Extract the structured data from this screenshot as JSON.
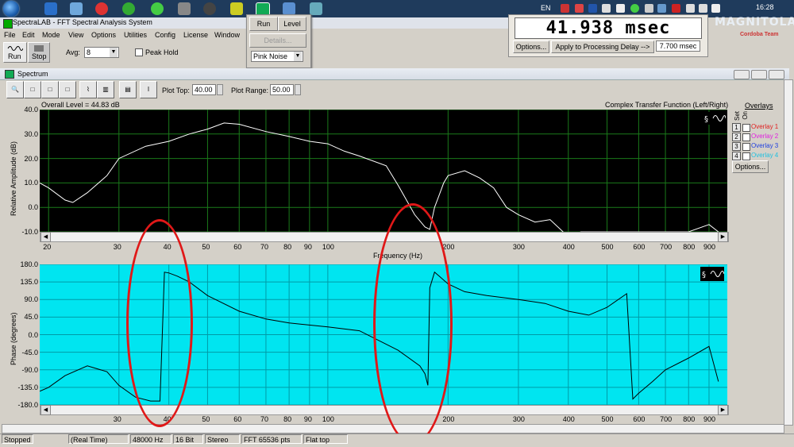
{
  "taskbar": {
    "lang": "EN",
    "clock": "16:28"
  },
  "app": {
    "title": "SpectraLAB - FFT Spectral Analysis System",
    "menu": [
      "File",
      "Edit",
      "Mode",
      "View",
      "Options",
      "Utilities",
      "Config",
      "License",
      "Window"
    ]
  },
  "toolbar": {
    "run_label": "Run",
    "stop_label": "Stop",
    "avg_label": "Avg:",
    "avg_value": "8",
    "peak_hold_label": "Peak Hold"
  },
  "run_panel": {
    "run_label": "Run",
    "level_label": "Level",
    "details_label": "Details...",
    "signal_value": "Pink Noise"
  },
  "delay_panel": {
    "display": "41.938 msec",
    "options_label": "Options...",
    "apply_label": "Apply to Processing Delay -->",
    "delay_value": "7.700 msec"
  },
  "brand": {
    "name": "MAGNITOLA",
    "sub": "Cordoba Team"
  },
  "spectrum_window": {
    "title": "Spectrum",
    "plot_top_label": "Plot Top:",
    "plot_top_value": "40.00",
    "plot_range_label": "Plot Range:",
    "plot_range_value": "50.00",
    "overall_level": "Overall Level = 44.83 dB",
    "function_label": "Complex Transfer Function (Left/Right)",
    "overlays": {
      "title": "Overlays",
      "set_label": "Set",
      "on_label": "On",
      "items": [
        {
          "num": "1",
          "label": "Overlay 1",
          "color": "#e02020"
        },
        {
          "num": "2",
          "label": "Overlay 2",
          "color": "#e020e0"
        },
        {
          "num": "3",
          "label": "Overlay 3",
          "color": "#2040e0"
        },
        {
          "num": "4",
          "label": "Overlay 4",
          "color": "#20c0e0"
        }
      ],
      "options_label": "Options..."
    },
    "amp_ylabel": "Relative Amplitude (dB)",
    "phase_ylabel": "Phase (degrees)",
    "freq_xlabel": "Frequency (Hz)"
  },
  "status_bar": [
    "Stopped",
    "(Real Time)",
    "48000 Hz",
    "16 Bit",
    "Stereo",
    "FFT 65536 pts",
    "Flat top"
  ],
  "chart_data": [
    {
      "type": "line",
      "title": "Complex Transfer Function (Left/Right)",
      "xlabel": "Frequency (Hz)",
      "ylabel": "Relative Amplitude (dB)",
      "xscale": "log",
      "xlim": [
        19,
        1000
      ],
      "ylim": [
        -10,
        40
      ],
      "xticks": [
        20,
        30,
        40,
        50,
        60,
        70,
        80,
        90,
        100,
        200,
        300,
        400,
        500,
        600,
        700,
        800,
        900
      ],
      "yticks": [
        "40.0",
        "30.0",
        "20.0",
        "10.0",
        "0.0",
        "-10.0"
      ],
      "grid": true,
      "series": [
        {
          "x": [
            19,
            20,
            22,
            23,
            25,
            28,
            30,
            35,
            40,
            45,
            50,
            55,
            60,
            70,
            80,
            90,
            100,
            110,
            120,
            140,
            150,
            165,
            175,
            180,
            185,
            190,
            195,
            200,
            220,
            240,
            260,
            280,
            300,
            330,
            360,
            400,
            430,
            500,
            560,
            600,
            700,
            800,
            900,
            950
          ],
          "y": [
            10,
            8,
            3,
            2,
            6,
            13,
            20,
            25,
            27,
            30,
            32,
            34.5,
            34,
            31,
            29,
            27,
            26,
            23,
            21,
            17,
            9,
            -3,
            -8,
            -9,
            0,
            5,
            10,
            13,
            15,
            12,
            8,
            0,
            -3,
            -6,
            -5,
            -12,
            -10,
            -10,
            -10,
            -10,
            -10,
            -10,
            -7,
            -10
          ]
        }
      ]
    },
    {
      "type": "line",
      "xlabel": "Frequency (Hz)",
      "ylabel": "Phase (degrees)",
      "xscale": "log",
      "xlim": [
        19,
        1000
      ],
      "ylim": [
        -180,
        180
      ],
      "xticks": [
        30,
        40,
        50,
        60,
        70,
        80,
        90,
        100,
        200,
        300,
        400,
        500,
        600,
        700,
        800,
        900
      ],
      "yticks": [
        "180.0",
        "135.0",
        "90.0",
        "45.0",
        "0.0",
        "-45.0",
        "-90.0",
        "-135.0",
        "-180.0"
      ],
      "grid": true,
      "series": [
        {
          "x": [
            19,
            20,
            22,
            25,
            28,
            30,
            33,
            36,
            38,
            39,
            40,
            42,
            45,
            50,
            60,
            70,
            80,
            100,
            120,
            150,
            170,
            175,
            178,
            180,
            185,
            190,
            200,
            220,
            250,
            300,
            350,
            400,
            450,
            500,
            560,
            580,
            600,
            650,
            700,
            800,
            900,
            950
          ],
          "y": [
            -145,
            -135,
            -105,
            -80,
            -95,
            -130,
            -160,
            -170,
            -170,
            160,
            158,
            150,
            135,
            100,
            60,
            40,
            30,
            20,
            10,
            -40,
            -80,
            -100,
            -130,
            120,
            160,
            150,
            130,
            110,
            100,
            90,
            80,
            60,
            50,
            70,
            105,
            -165,
            -150,
            -120,
            -90,
            -60,
            -30,
            -120
          ]
        }
      ]
    }
  ]
}
